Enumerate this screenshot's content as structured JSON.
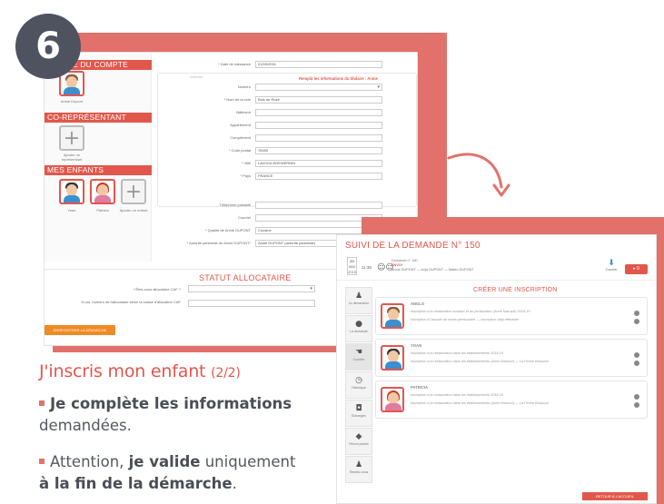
{
  "step_number": "6",
  "shot1": {
    "section_titulaire": "AIRE DU COMPTE",
    "section_corep": "CO-REPRÉSENTANT",
    "section_enfants": "MES ENFANTS",
    "titulaire_caption": "Annie Dupont",
    "corep_caption": "Ajouter un représentant",
    "children": [
      "Yoan",
      "Patricia",
      "Ajouter un enfant"
    ],
    "form": {
      "date_label": "* Date de naissance",
      "date_value": "01/09/2001",
      "adresse_legend": "Adresse",
      "copy_link": "Remplir les informations du titulaire : Annie",
      "fields": [
        {
          "label": "Numéro",
          "value": ""
        },
        {
          "label": "* Nom de la voie",
          "value": "Bois de Rozé"
        },
        {
          "label": "Bâtiment",
          "value": ""
        },
        {
          "label": "Appartement",
          "value": ""
        },
        {
          "label": "Complément",
          "value": ""
        },
        {
          "label": "* Code postal",
          "value": "78490"
        },
        {
          "label": "* Ville",
          "value": "LAVOIULEDEWERNIN"
        },
        {
          "label": "* Pays",
          "value": "FRANCE"
        }
      ],
      "tel_label": "Téléphone portable",
      "courriel_label": "Courriel",
      "qualite_label": "* Qualité de Annie DUPONT",
      "qualite_value": "Cousine",
      "qualite2_label": "* Autorité parentale de Annie DUPONT*",
      "qualite2_value": "Annie DUPONT (autorité parentale)"
    },
    "statut_title": "STATUT ALLOCATAIRE",
    "caf_label": "* Êtes-vous allocataire CAF ?",
    "caf_number_label": "Si oui, numéro de l'allocataire selon la caisse d'allocation CAF",
    "save_button": "ENREGISTRER LA DÉMARCHE"
  },
  "shot2": {
    "title": "SUIVI DE LA DEMANDE N° 150",
    "date_day": "20",
    "date_month": "MAI",
    "date_year": "2019",
    "time": "11:38",
    "meta_line1": "Demande n° 150",
    "meta_status": "ENVOI",
    "meta_line2": "Annie DUPONT — Anja DUPONT — Mateo DUPONT",
    "download_label": "Courrier",
    "red_button": "▸ 0",
    "side_tabs": [
      "Le demandeur",
      "La demande",
      "Courrier",
      "Historique",
      "Échanges",
      "Pièces jointes",
      "Rendez-vous"
    ],
    "creer_title": "CRÉER UNE INSCRIPTION",
    "children": [
      {
        "name": "ANGLO",
        "line1": "Inscription à la restauration scolaire et au périscolaire (Anne Maruzzi) 2018-19",
        "line2": "Inscription à l'accueil de loisirs périscolaire — inscription déjà effectuée"
      },
      {
        "name": "YOAN",
        "line1": "Inscription à la restauration dans les établissements 2018-19",
        "line2": "Inscription à la restauration dans les établissements (Anne Maruzzi) — La Ferme Beauvoir"
      },
      {
        "name": "PATRICIA",
        "line1": "Inscription à la restauration dans les établissements 2018-19",
        "line2": "Inscription à la restauration dans les établissements (Anne Maruzzi) — La Ferme Beauvoir"
      }
    ],
    "bottom_button": "RETOUR À L'ACCUEIL"
  },
  "caption": {
    "heading": "J'inscris mon enfant",
    "heading_step": "(2/2)",
    "bullet1_bold": "Je complète les informations",
    "bullet1_rest": "demandées.",
    "bullet2_pre": "Attention,",
    "bullet2_bold1": "je valide",
    "bullet2_mid": "uniquement",
    "bullet2_bold2": "à la fin de la démarche",
    "bullet2_end": "."
  },
  "colors": {
    "accent": "#e2574c",
    "frame": "#e2716c",
    "badge": "#4f5360"
  }
}
